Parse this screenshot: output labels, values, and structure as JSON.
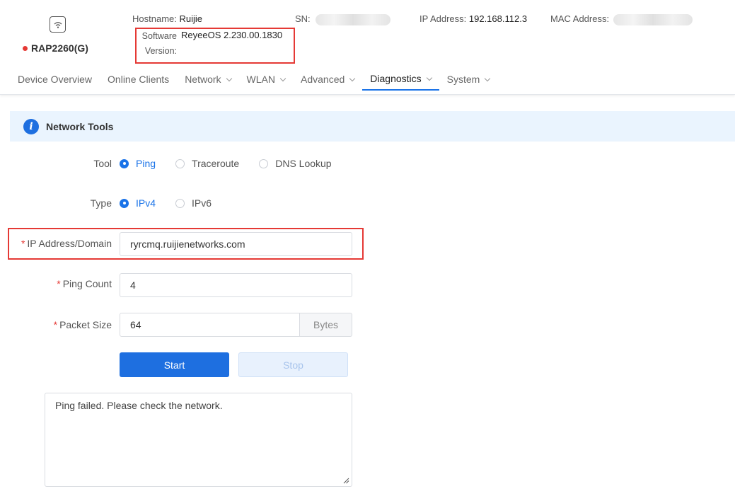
{
  "device": {
    "name": "RAP2260(G)",
    "icon": "wifi-icon",
    "status_color": "#e53935"
  },
  "header": {
    "hostname_label": "Hostname:",
    "hostname_value": "Ruijie",
    "sn_label": "SN:",
    "ip_label": "IP Address:",
    "ip_value": "192.168.112.3",
    "mac_label": "MAC Address:",
    "software_label_line1": "Software",
    "software_label_line2": "Version:",
    "software_value": "ReyeeOS 2.230.00.1830"
  },
  "nav": {
    "items": [
      {
        "label": "Device Overview",
        "dropdown": false
      },
      {
        "label": "Online Clients",
        "dropdown": false
      },
      {
        "label": "Network",
        "dropdown": true
      },
      {
        "label": "WLAN",
        "dropdown": true
      },
      {
        "label": "Advanced",
        "dropdown": true
      },
      {
        "label": "Diagnostics",
        "dropdown": true,
        "active": true
      },
      {
        "label": "System",
        "dropdown": true
      }
    ]
  },
  "section": {
    "title": "Network Tools",
    "icon": "info-icon"
  },
  "form": {
    "tool_label": "Tool",
    "tool_options": [
      "Ping",
      "Traceroute",
      "DNS Lookup"
    ],
    "tool_selected": "Ping",
    "type_label": "Type",
    "type_options": [
      "IPv4",
      "IPv6"
    ],
    "type_selected": "IPv4",
    "ip_label": "IP Address/Domain",
    "ip_value": "ryrcmq.ruijienetworks.com",
    "count_label": "Ping Count",
    "count_value": "4",
    "size_label": "Packet Size",
    "size_value": "64",
    "size_unit": "Bytes",
    "required_mark": "*"
  },
  "buttons": {
    "start": "Start",
    "stop": "Stop"
  },
  "result": {
    "text": "Ping failed. Please check the network."
  },
  "colors": {
    "accent": "#1e6fe0",
    "highlight_box": "#e53935",
    "section_bg": "#eaf4fe"
  }
}
